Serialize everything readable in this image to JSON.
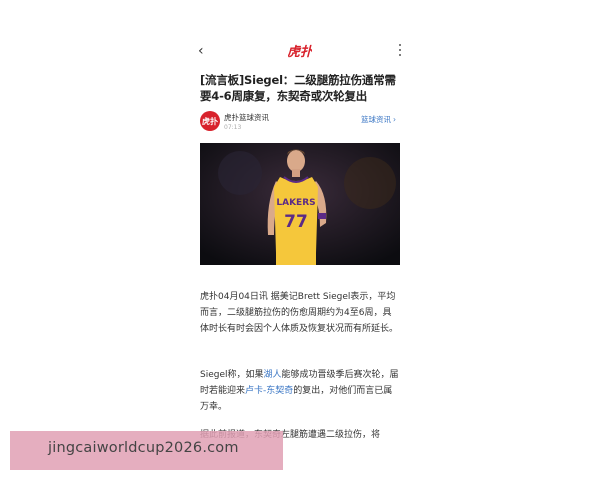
{
  "topbar": {
    "back_glyph": "‹",
    "logo_text": "虎扑",
    "logo_color": "#d8222c"
  },
  "article": {
    "title": "[流言板]Siegel：二级腿筋拉伤通常需要4-6周康复，东契奇或次轮复出",
    "source": {
      "avatar_text": "虎扑",
      "name": "虎扑篮球资讯",
      "date": "07:13",
      "channel_link": "篮球资讯",
      "channel_link_color": "#3a76c4"
    },
    "photo": {
      "jersey_team": "LAKERS",
      "jersey_number": "77"
    },
    "paragraphs": {
      "p1": "虎扑04月04日讯 据美记Brett Siegel表示，平均而言，二级腿筋拉伤的伤愈周期约为4至6周，具体时长有时会因个人体质及恢复状况而有所延长。",
      "p2_a": "Siegel称，如果",
      "p2_link1": "湖人",
      "p2_b": "能够成功晋级季后赛次轮，届时若能迎来",
      "p2_link2": "卢卡-东契奇",
      "p2_c": "的复出，对他们而言已属万幸。",
      "p3": "据此前报道，东契奇左腿筋遭遇二级拉伤，将"
    }
  },
  "watermark": {
    "text": "jingcaiworldcup2026.com"
  },
  "icons": [
    "back-icon",
    "more-icon",
    "chevron-right-icon"
  ]
}
